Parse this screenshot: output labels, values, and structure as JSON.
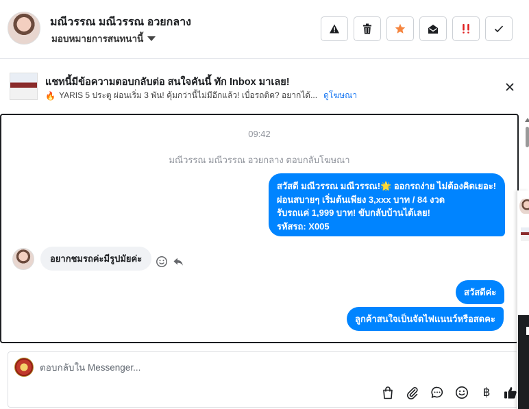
{
  "header": {
    "contact_name": "มณีวรรณ มณีวรรณ อวยกลาง",
    "assign_label": "มอบหมายการสนทนานี้",
    "actions": [
      {
        "name": "warning-icon",
        "color": "#1c1e21"
      },
      {
        "name": "trash-icon",
        "color": "#1c1e21"
      },
      {
        "name": "star-icon",
        "color": "#f5853f"
      },
      {
        "name": "envelope-open-icon",
        "color": "#1c1e21"
      },
      {
        "name": "double-exclamation-icon",
        "color": "#e02020"
      },
      {
        "name": "check-icon",
        "color": "#1c1e21"
      }
    ]
  },
  "ad": {
    "title": "แชทนี้มีข้อความตอบกลับต่อ สนใจคันนี้ ทัก Inbox มาเลย!",
    "subtitle_emoji": "🔥",
    "subtitle": "YARIS 5 ประตู ผ่อนเริ่ม 3 พัน! คุ้มกว่านี้ไม่มีอีกแล้ว! เบื่อรถติด? อยากได้...",
    "link": "ดูโฆษณา"
  },
  "chat": {
    "timestamp": "09:42",
    "system_note": "มณีวรรณ มณีวรรณ อวยกลาง ตอบกลับโฆษณา",
    "outgoing_big": {
      "line1": "สวัสดี มณีวรรณ มณีวรรณ!🌟 ออกรถง่าย ไม่ต้องคิดเยอะ!",
      "line2": "ผ่อนสบายๆ เริ่มต้นเพียง 3,xxx บาท / 84 งวด",
      "line3": "รับรถแค่ 1,999 บาท! ขับกลับบ้านได้เลย!",
      "line4": "รหัสรถ: X005"
    },
    "incoming": "อยากชมรถค่ะมีรูปมัยค่ะ",
    "outgoing_1": "สวัสดีค่ะ",
    "outgoing_2": "ลูกค้าสนใจเป็นจัดไฟแนนว์หรือสดคะ"
  },
  "composer": {
    "placeholder": "ตอบกลับใน Messenger...",
    "tools": [
      "shopping-bag-icon",
      "paperclip-icon",
      "chat-bubble-icon",
      "emoji-icon",
      "baht-icon",
      "thumbs-up-icon"
    ],
    "baht_symbol": "฿"
  },
  "colors": {
    "accent": "#0084ff",
    "link": "#1877f2",
    "incoming_bubble": "#f0f2f5",
    "star": "#f5853f",
    "alert": "#e02020"
  }
}
